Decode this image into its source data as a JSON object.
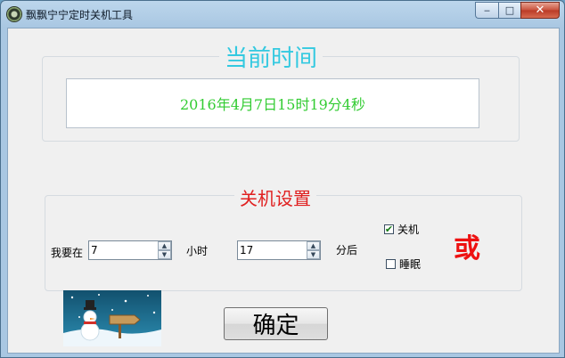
{
  "window": {
    "title": "飘飘宁宁定时关机工具",
    "caption_buttons": {
      "minimize": "‒",
      "maximize": "□",
      "close": "✕"
    }
  },
  "current_time": {
    "legend": "当前时间",
    "value": "2016年4月7日15时19分4秒"
  },
  "shutdown_settings": {
    "legend": "关机设置",
    "prefix_label": "我要在",
    "hours_value": "7",
    "hours_label": "小时",
    "minutes_value": "17",
    "minutes_suffix": "分后",
    "option_shutdown": {
      "label": "关机",
      "checked": true
    },
    "option_sleep": {
      "label": "睡眠",
      "checked": false
    },
    "or_label": "或"
  },
  "confirm_button": {
    "label": "确定"
  },
  "colors": {
    "current_time_legend": "#33c9e0",
    "time_text": "#33cc33",
    "settings_legend": "#e02020",
    "or_text": "#ee1111"
  },
  "icons": [
    "app-icon",
    "spin-up-icon",
    "spin-down-icon",
    "check-icon",
    "snowman-image"
  ]
}
